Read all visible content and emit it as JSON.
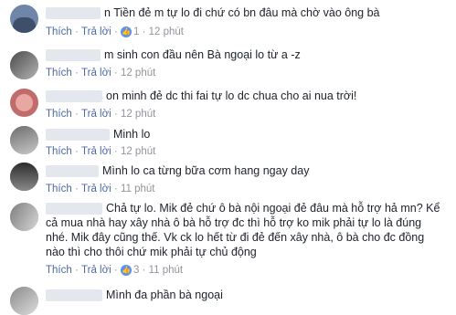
{
  "actions": {
    "like": "Thích",
    "reply": "Trả lời",
    "dot": "·"
  },
  "like_icon": "thumbs-up-icon",
  "comments": [
    {
      "text": "n Tiền đẻ m tự lo đi chứ có bn đâu mà chờ vào ông bà",
      "reactions": "1",
      "time": "12 phút"
    },
    {
      "text": "m sinh con đầu nên Bà ngoại lo từ a -z",
      "reactions": "",
      "time": "12 phút"
    },
    {
      "text": "on minh đẻ dc thi fai tự lo dc chua cho ai nua trời!",
      "reactions": "",
      "time": "12 phút"
    },
    {
      "text": "Minh lo",
      "reactions": "",
      "time": "12 phút"
    },
    {
      "text": "Mình lo ca từng bữa cơm hang ngay day",
      "reactions": "",
      "time": "11 phút"
    },
    {
      "text": "Chả tự lo. Mik đẻ chứ ô bà nội ngoại đẻ đâu mà hỗ trợ hả mn? Kể cả mua nhà hay xây nhà ô bà hỗ trợ đc thì hỗ trợ ko mik phải tự lo là đúng nhé. Mik đây cũng thế. Vk ck lo hết từ đi đẻ đến xây nhà, ô bà cho đc đồng nào thì cho thôi chứ mik phải tự chủ động",
      "reactions": "3",
      "time": "11 phút"
    },
    {
      "text": "Mình đa phần bà ngoại",
      "reactions": "",
      "time": ""
    }
  ]
}
